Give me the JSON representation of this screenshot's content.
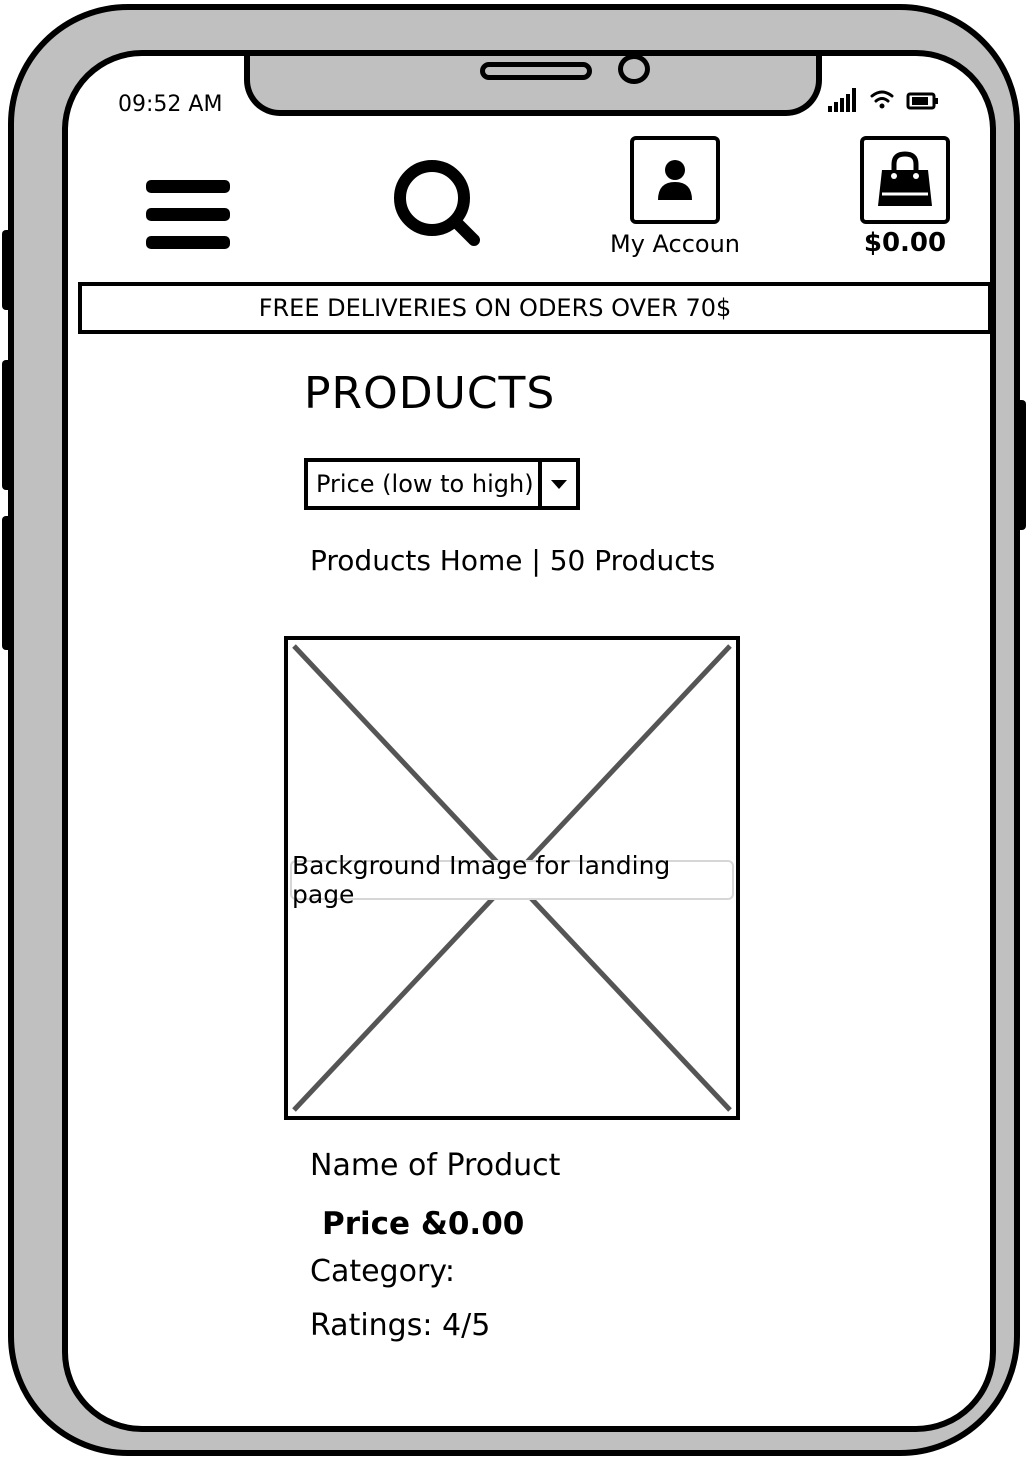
{
  "status_bar": {
    "time": "09:52 AM"
  },
  "header": {
    "menu_icon": "hamburger-menu-icon",
    "search_icon": "search-icon",
    "account": {
      "icon": "user-icon",
      "label": "My Accoun"
    },
    "cart": {
      "icon": "shopping-bag-icon",
      "total": "$0.00"
    }
  },
  "banner": {
    "text": "FREE DELIVERIES ON ODERS OVER 70$"
  },
  "main": {
    "title": "PRODUCTS",
    "sort": {
      "selected": "Price (low to high)"
    },
    "breadcrumb": "Products Home | 50 Products"
  },
  "product": {
    "image_caption": "Background Image for landing page",
    "name": "Name of Product",
    "price": "Price &0.00",
    "category": "Category:",
    "ratings": "Ratings: 4/5"
  },
  "colors": {
    "frame": "#c0c0c0",
    "outline": "#000000",
    "screen": "#ffffff"
  }
}
